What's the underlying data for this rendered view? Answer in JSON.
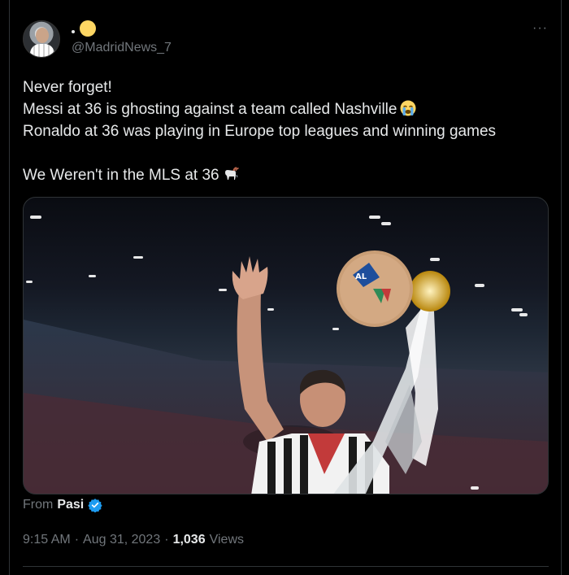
{
  "author": {
    "handle": "@MadridNews_7",
    "display_name_marker": ".",
    "avatar_icon": "avatar-ronaldo-photo",
    "name_emoji_color": "#fdd663"
  },
  "more_label": "···",
  "body": {
    "lines": [
      "Never forget!",
      "Messi at 36 is ghosting against a team called Nashville",
      "Ronaldo at 36 was playing in Europe top leagues and winning games",
      "We Weren't in the MLS at 36"
    ],
    "line_emojis": [
      "",
      "crying-face-emoji",
      "",
      "goat-emoji"
    ]
  },
  "media": {
    "description_icon": "photo-player-lifting-trophy"
  },
  "source": {
    "prefix": "From",
    "name": "Pasi",
    "badge_icon": "verified-badge-icon",
    "badge_color": "#1d9bf0"
  },
  "meta": {
    "time": "9:15 AM",
    "separator": "·",
    "date": "Aug 31, 2023",
    "views_count": "1,036",
    "views_label": "Views"
  },
  "colors": {
    "background": "#000000",
    "text": "#e7e9ea",
    "muted": "#71767b",
    "border": "#2f3336"
  }
}
